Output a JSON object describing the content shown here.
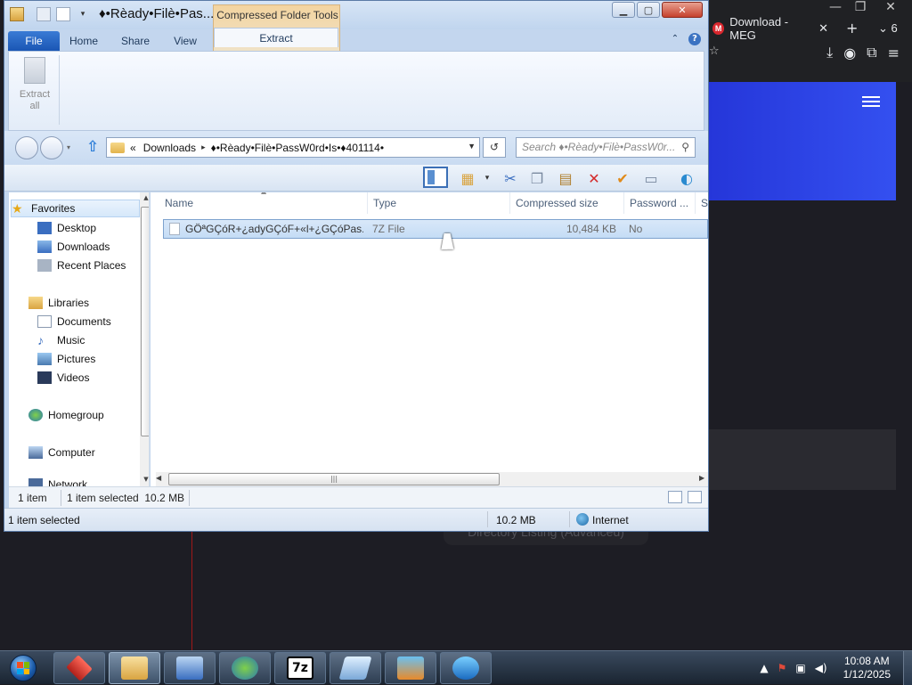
{
  "browser": {
    "tab_title": "Download - MEG",
    "tab_close": "✕",
    "new_tab": "+",
    "tab_count": "6",
    "bottom_pill": "Directory Listing (Advanced)"
  },
  "explorer": {
    "title": "♦•Rèady•Filè•Pas...",
    "contextual_tab_group": "Compressed Folder Tools",
    "tabs": [
      "File",
      "Home",
      "Share",
      "View",
      "Extract"
    ],
    "ribbon": {
      "extract_all_label": "Extract all"
    },
    "address": {
      "overflow": "«",
      "crumbs": [
        "Downloads",
        "♦•Rèady•Filè•PassW0rd•Is•♦401114•"
      ]
    },
    "search_placeholder": "Search ♦•Rèady•Filè•PassW0r...",
    "nav_pane": {
      "favorites": "Favorites",
      "desktop": "Desktop",
      "downloads": "Downloads",
      "recent_places": "Recent Places",
      "libraries": "Libraries",
      "documents": "Documents",
      "music": "Music",
      "pictures": "Pictures",
      "videos": "Videos",
      "homegroup": "Homegroup",
      "computer": "Computer",
      "network": "Network"
    },
    "columns": [
      "Name",
      "Type",
      "Compressed size",
      "Password ...",
      "Si"
    ],
    "files": [
      {
        "name": "GÖªGÇóR+¿adyGÇóF+«l+¿GÇóPas...",
        "type": "7Z File",
        "compressed_size": "10,484 KB",
        "password": "No"
      }
    ],
    "status_inner": {
      "count": "1 item",
      "selected": "1 item selected  10.2 MB"
    },
    "status_outer": {
      "selected": "1 item selected",
      "size": "10.2 MB",
      "zone": "Internet"
    }
  },
  "taskbar": {
    "time": "10:08 AM",
    "date": "1/12/2025",
    "sevenzip_label": "7z"
  },
  "colors": {
    "accent_blue": "#1a56b4",
    "contextual_orange": "#f3d4a0",
    "browser_panel_blue": "#2536d9"
  }
}
